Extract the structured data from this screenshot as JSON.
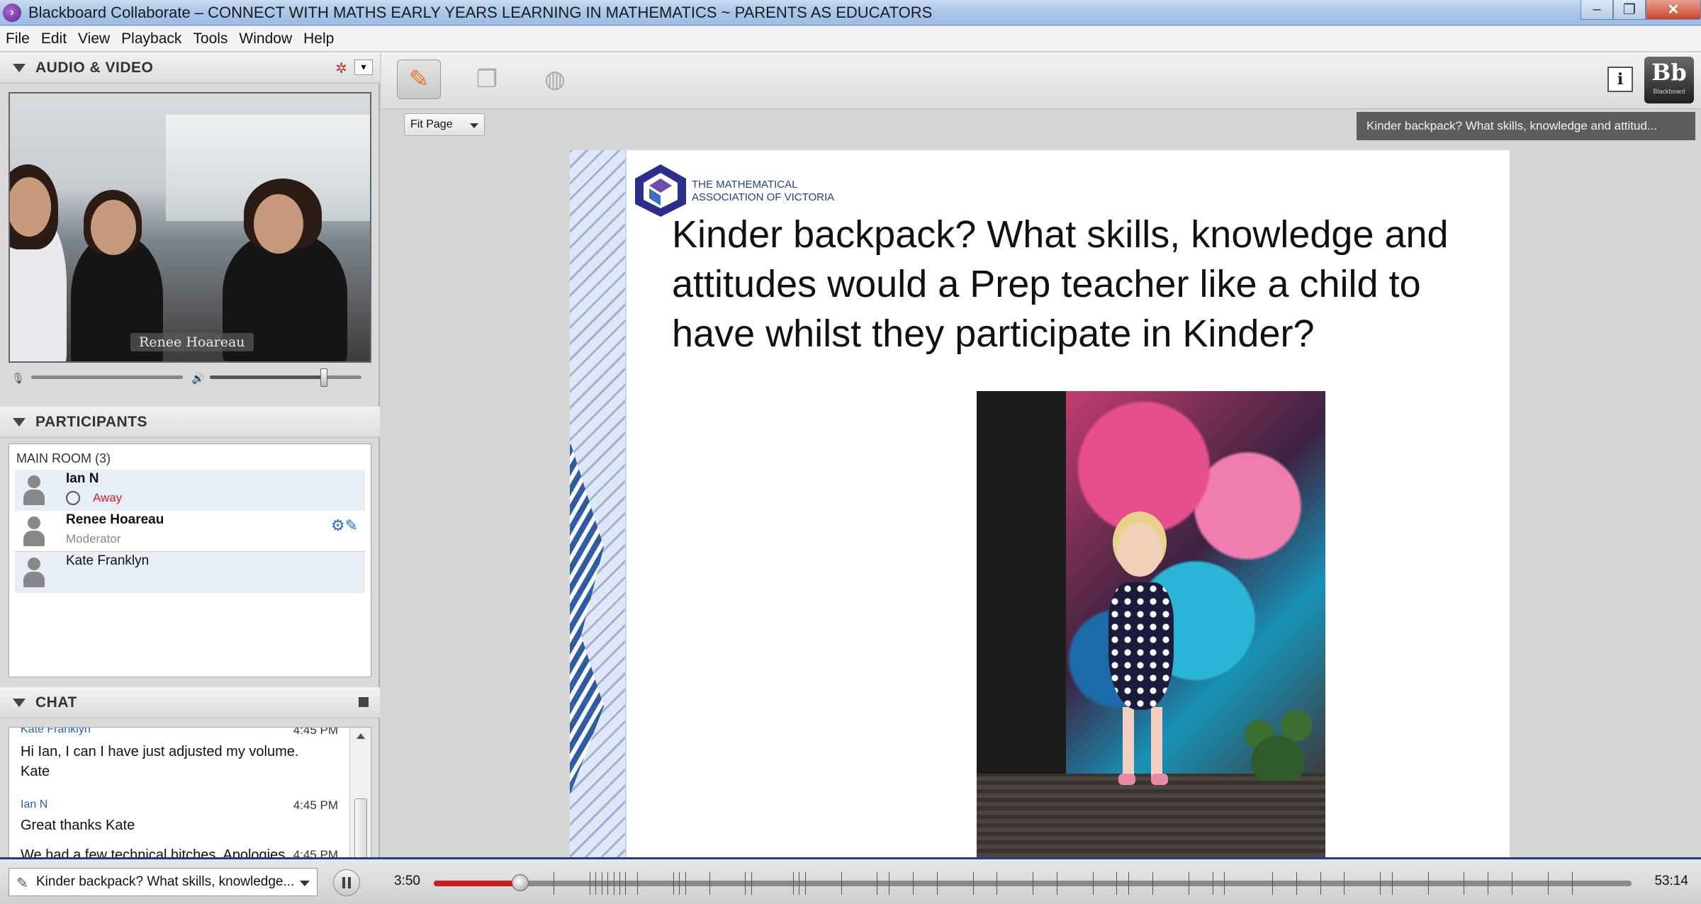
{
  "window": {
    "title": "Blackboard Collaborate – CONNECT WITH MATHS EARLY YEARS LEARNING IN MATHEMATICS ~ PARENTS AS EDUCATORS",
    "minimize": "–",
    "restore": "❐",
    "close": "✕"
  },
  "menu": [
    "File",
    "Edit",
    "View",
    "Playback",
    "Tools",
    "Window",
    "Help"
  ],
  "audio_video": {
    "title": "AUDIO & VIDEO",
    "speaker_name": "Renee Hoareau",
    "mic_level": 0.0,
    "volume_level": 0.75
  },
  "participants": {
    "title": "PARTICIPANTS",
    "room": "MAIN ROOM",
    "count": "(3)",
    "list": [
      {
        "name": "Ian N",
        "status": "Away"
      },
      {
        "name": "Renee Hoareau",
        "role": "Moderator"
      },
      {
        "name": "Kate Franklyn"
      }
    ]
  },
  "chat": {
    "title": "CHAT",
    "messages": [
      {
        "author": "Kate Franklyn",
        "time": "4:45 PM",
        "text": "Hi Ian, I can I have just adjusted my volume. Kate"
      },
      {
        "author": "Ian N",
        "time": "4:45 PM",
        "text": "Great thanks Kate"
      },
      {
        "author": "",
        "time": "4:45 PM",
        "text": "We had a few technical hitches. Apologies"
      }
    ]
  },
  "stage": {
    "zoom": "Fit Page",
    "slide_title_chip": "Kinder backpack? What skills, knowledge and attitud...",
    "slide": {
      "logo_text_line1": "THE MATHEMATICAL",
      "logo_text_line2": "ASSOCIATION OF VICTORIA",
      "heading": "Kinder backpack? What skills, knowledge and attitudes would a Prep teacher like a child to have whilst they participate in Kinder?"
    }
  },
  "toolbar": {
    "info": "i",
    "brand": "Bb",
    "brand_sub": "Blackboard"
  },
  "playback": {
    "slide_select": "Kinder backpack? What skills, knowledge...",
    "current_time": "3:50",
    "total_time": "53:14",
    "progress": 0.072
  },
  "colors": {
    "accent_red": "#d01a1a",
    "link_blue": "#2a5db0",
    "away_red": "#d02020"
  }
}
